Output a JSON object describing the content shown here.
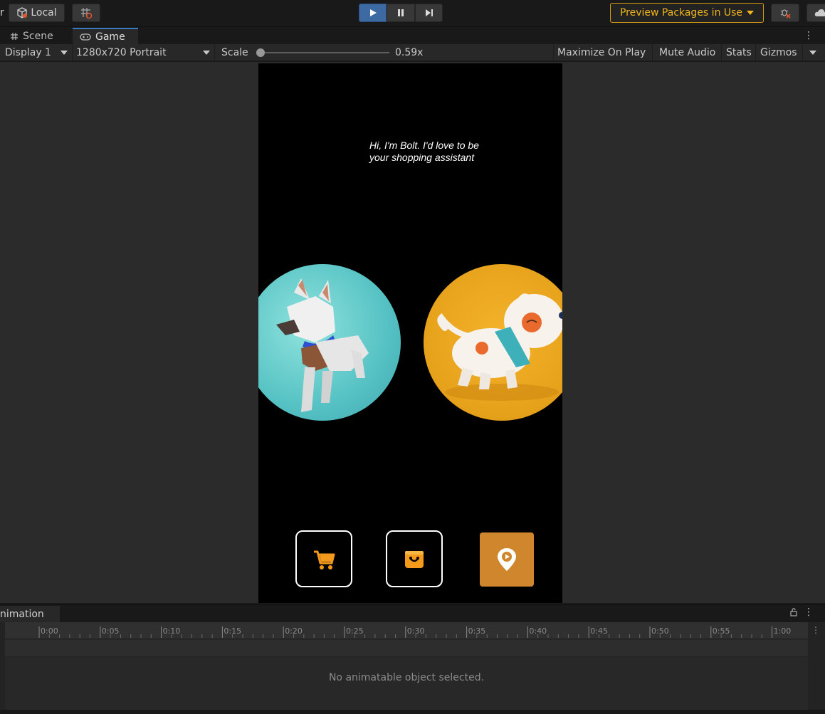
{
  "toolbar": {
    "left_cut_label": "r",
    "local_label": "Local",
    "preview_label": "Preview Packages in Use",
    "accent_play": "#3d6aa3",
    "preview_color": "#f0b41c"
  },
  "tabs": {
    "scene": "Scene",
    "game": "Game"
  },
  "gamebar": {
    "display": "Display 1",
    "resolution": "1280x720 Portrait",
    "scale_label": "Scale",
    "scale_value": "0.59x",
    "scale_level": 0.0,
    "maximize": "Maximize On Play",
    "mute": "Mute Audio",
    "stats": "Stats",
    "gizmos": "Gizmos"
  },
  "game": {
    "bolt_text": "Hi, I'm Bolt. I'd love to be your shopping assistant",
    "circles": [
      "white-lowpoly-dog",
      "cartoon-dog-orange-spots"
    ],
    "buttons": [
      "cart-icon",
      "shopping-bag-icon",
      "map-pin-icon"
    ],
    "accent": "#d0862d"
  },
  "animation": {
    "tab_label": "nimation",
    "ticks": [
      "0:00",
      "0:05",
      "0:10",
      "0:15",
      "0:20",
      "0:25",
      "0:30",
      "0:35",
      "0:40",
      "0:45",
      "0:50",
      "0:55",
      "1:00"
    ],
    "empty_message": "No animatable object selected."
  }
}
